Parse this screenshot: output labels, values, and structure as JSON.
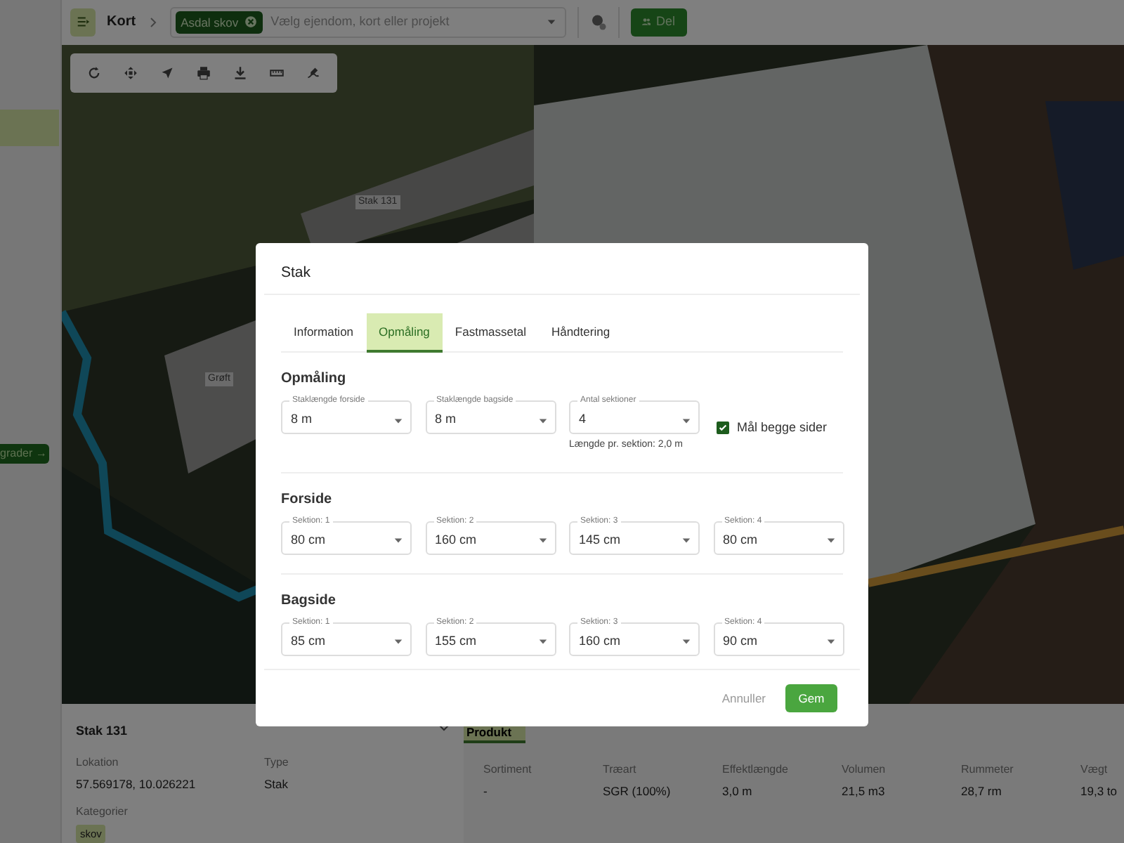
{
  "sidebar": {
    "button": "grader →"
  },
  "topbar": {
    "breadcrumb": "Kort",
    "chip": "Asdal skov",
    "search_placeholder": "Vælg ejendom, kort eller projekt",
    "share_button": "Del"
  },
  "map": {
    "labels": [
      {
        "text": "Stak 131",
        "kind": "stack"
      },
      {
        "text": "Grøft",
        "kind": "ditch"
      }
    ]
  },
  "details": {
    "title": "Stak 131",
    "fields": [
      {
        "label": "Lokation",
        "value": "57.569178, 10.026221"
      },
      {
        "label": "Type",
        "value": "Stak"
      }
    ],
    "category_label": "Kategorier",
    "tags": [
      "skov"
    ]
  },
  "product": {
    "tab": "Produkt",
    "columns": [
      {
        "label": "Sortiment",
        "value": "-"
      },
      {
        "label": "Træart",
        "value": "SGR (100%)"
      },
      {
        "label": "Effektlængde",
        "value": "3,0 m"
      },
      {
        "label": "Volumen",
        "value": "21,5 m3"
      },
      {
        "label": "Rummeter",
        "value": "28,7 rm"
      },
      {
        "label": "Vægt",
        "value": "19,3 to"
      }
    ]
  },
  "dialog": {
    "title": "Stak",
    "tabs": [
      {
        "label": "Information",
        "selected": false
      },
      {
        "label": "Opmåling",
        "selected": true
      },
      {
        "label": "Fastmassetal",
        "selected": false
      },
      {
        "label": "Håndtering",
        "selected": false
      }
    ],
    "measure": {
      "heading": "Opmåling",
      "fields": [
        {
          "label": "Staklængde forside",
          "value": "8 m"
        },
        {
          "label": "Staklængde bagside",
          "value": "8 m"
        },
        {
          "label": "Antal sektioner",
          "value": "4"
        }
      ],
      "note": "Længde pr. sektion: 2,0 m",
      "checkbox": {
        "label": "Mål begge sider",
        "checked": true
      }
    },
    "sections": [
      {
        "heading": "Forside",
        "fields": [
          {
            "label": "Sektion: 1",
            "value": "80 cm"
          },
          {
            "label": "Sektion: 2",
            "value": "160 cm"
          },
          {
            "label": "Sektion: 3",
            "value": "145 cm"
          },
          {
            "label": "Sektion: 4",
            "value": "80 cm"
          }
        ]
      },
      {
        "heading": "Bagside",
        "fields": [
          {
            "label": "Sektion: 1",
            "value": "85 cm"
          },
          {
            "label": "Sektion: 2",
            "value": "155 cm"
          },
          {
            "label": "Sektion: 3",
            "value": "160 cm"
          },
          {
            "label": "Sektion: 4",
            "value": "90 cm"
          }
        ]
      }
    ],
    "cancel": "Annuller",
    "save": "Gem"
  }
}
